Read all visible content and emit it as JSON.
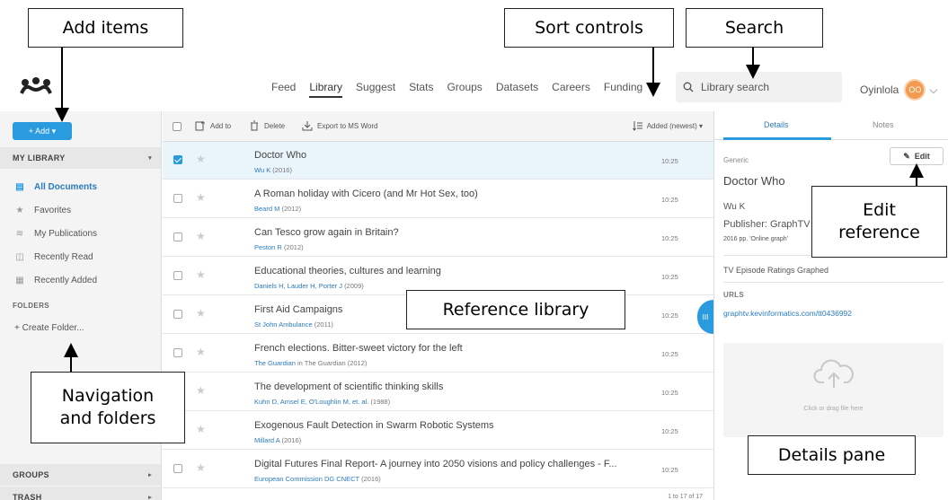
{
  "nav": {
    "items": [
      "Feed",
      "Library",
      "Suggest",
      "Stats",
      "Groups",
      "Datasets",
      "Careers",
      "Funding"
    ],
    "active_index": 1
  },
  "search": {
    "placeholder": "Library search"
  },
  "user": {
    "name": "Oyinlola",
    "initials": "OO"
  },
  "sidebar": {
    "add_label": "+ Add ▾",
    "my_library_label": "MY LIBRARY",
    "items": [
      {
        "label": "All Documents",
        "icon": "documents-icon",
        "active": true
      },
      {
        "label": "Favorites",
        "icon": "star-icon",
        "active": false
      },
      {
        "label": "My Publications",
        "icon": "publications-icon",
        "active": false
      },
      {
        "label": "Recently Read",
        "icon": "book-icon",
        "active": false
      },
      {
        "label": "Recently Added",
        "icon": "calendar-icon",
        "active": false
      }
    ],
    "folders_label": "FOLDERS",
    "create_folder_label": "+  Create Folder...",
    "groups_label": "GROUPS",
    "trash_label": "TRASH"
  },
  "toolbar": {
    "add_to_label": "Add to",
    "delete_label": "Delete",
    "export_label": "Export to MS Word",
    "sort_label": "Added (newest) ▾"
  },
  "documents": [
    {
      "title": "Doctor Who",
      "authors": "Wu K",
      "year": "(2016)",
      "time": "10:25",
      "selected": true
    },
    {
      "title": "A Roman holiday with Cicero (and Mr Hot Sex, too)",
      "authors": "Beard M",
      "year": "(2012)",
      "time": "10:25",
      "selected": false
    },
    {
      "title": "Can Tesco grow again in Britain?",
      "authors": "Peston R",
      "year": "(2012)",
      "time": "10:25",
      "selected": false
    },
    {
      "title": "Educational theories, cultures and learning",
      "authors": "Daniels H, Lauder H, Porter J",
      "year": "(2009)",
      "time": "10:25",
      "selected": false
    },
    {
      "title": "First Aid Campaigns",
      "authors": "St John Ambulance",
      "year": "(2011)",
      "time": "10:25",
      "selected": false
    },
    {
      "title": "French elections. Bitter-sweet victory for the left",
      "authors": "The Guardian",
      "year": "in The Guardian (2012)",
      "time": "10:25",
      "selected": false
    },
    {
      "title": "The development of scientific thinking skills",
      "authors": "Kuhn D, Amsel E, O'Loughlin M, et. al.",
      "year": "(1988)",
      "time": "10:25",
      "selected": false
    },
    {
      "title": "Exogenous Fault Detection in Swarm Robotic Systems",
      "authors": "Millard A",
      "year": "(2016)",
      "time": "10:25",
      "selected": false
    },
    {
      "title": "Digital Futures Final Report- A journey into 2050 visions and policy challenges - F...",
      "authors": "European Commission DG CNECT",
      "year": "(2016)",
      "time": "10:25",
      "selected": false
    }
  ],
  "pager": "1 to 17 of 17",
  "details": {
    "tab_details": "Details",
    "tab_notes": "Notes",
    "type": "Generic",
    "edit_label": "Edit",
    "title": "Doctor Who",
    "author": "Wu K",
    "publisher": "Publisher: GraphTV",
    "pages": "2016 pp. 'Online graph'",
    "description": "TV Episode Ratings Graphed",
    "urls_label": "URLS",
    "url": "graphtv.kevinformatics.com/tt0436992",
    "dropzone_text": "Click or drag file here"
  },
  "callouts": {
    "add_items": "Add items",
    "sort_controls": "Sort controls",
    "search": "Search",
    "edit_reference_1": "Edit",
    "edit_reference_2": "reference",
    "reference_library": "Reference library",
    "navigation_1": "Navigation",
    "navigation_2": "and folders",
    "details_pane": "Details pane"
  },
  "colors": {
    "accent": "#2a9bdf",
    "link": "#2a7bbf",
    "avatar": "#f39a4e"
  }
}
